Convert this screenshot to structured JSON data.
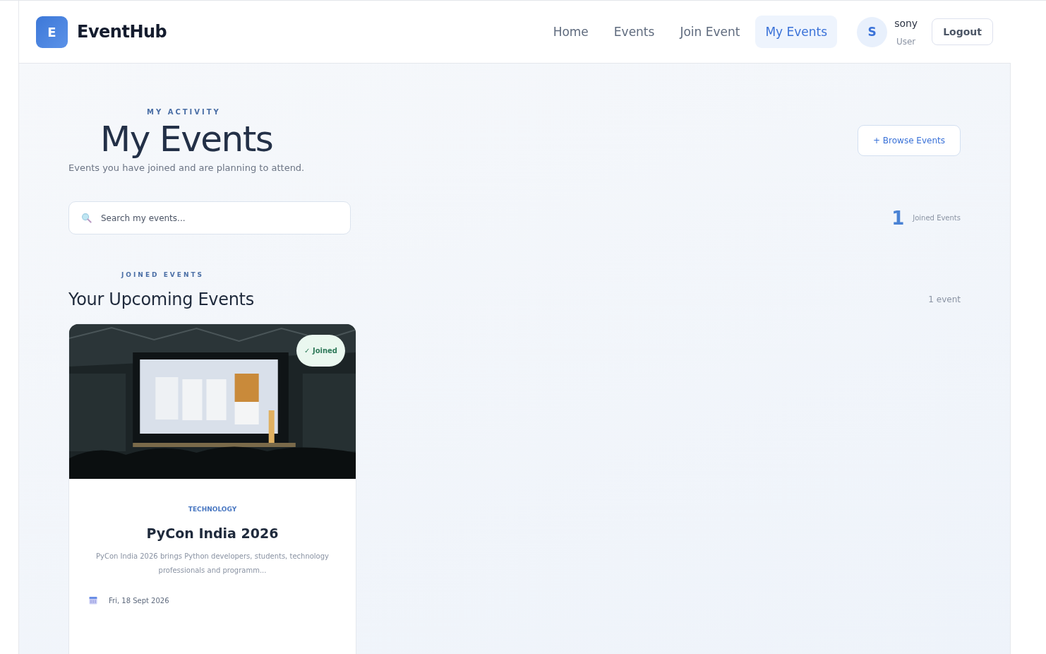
{
  "brand": {
    "logo_letter": "E",
    "name": "EventHub"
  },
  "nav": [
    {
      "label": "Home",
      "selected": false
    },
    {
      "label": "Events",
      "selected": false
    },
    {
      "label": "Join Event",
      "selected": false
    },
    {
      "label": "My Events",
      "selected": true
    }
  ],
  "user": {
    "initial": "S",
    "name": "sony",
    "role": "User"
  },
  "logout": "Logout",
  "hero": {
    "eyebrow": "MY ACTIVITY",
    "title": "My Events",
    "subtitle": "Events you have joined and are planning to attend.",
    "action": "+ Browse Events"
  },
  "search": {
    "placeholder": "Search my events..."
  },
  "stat": {
    "value": "1",
    "label": "Joined Events"
  },
  "section": {
    "eyebrow": "JOINED EVENTS",
    "title": "Your Upcoming Events",
    "count": "1 event"
  },
  "events": [
    {
      "kind": "picture",
      "badge": "✓ Joined",
      "category": "TECHNOLOGY",
      "title": "PyCon India 2026",
      "description": "PyCon India 2026 brings Python developers, students, technology professionals and programm...",
      "date": "Fri, 18 Sept 2026"
    }
  ]
}
